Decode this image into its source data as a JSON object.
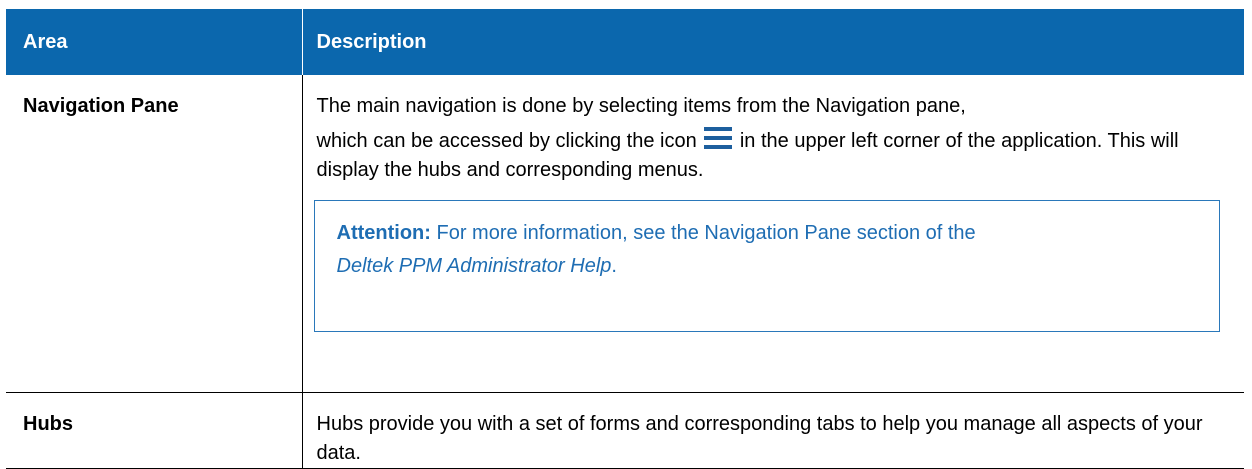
{
  "table": {
    "headers": {
      "area": "Area",
      "description": "Description"
    },
    "rows": {
      "navigation": {
        "area": "Navigation Pane",
        "desc_line1": "The main navigation is done by selecting items from the Navigation pane,",
        "desc_before_icon": "which can be accessed by clicking the icon",
        "icon": "hamburger-menu-icon",
        "desc_after_icon": "in the upper left corner of the application. This will display the hubs and corresponding menus.",
        "attention": {
          "label": "Attention:",
          "text": "For more information, see the Navigation Pane section of the",
          "italic": "Deltek PPM Administrator Help",
          "suffix": "."
        }
      },
      "hubs": {
        "area": "Hubs",
        "description": "Hubs provide you with a set of forms and corresponding tabs to help you manage all aspects of your data."
      }
    }
  },
  "colors": {
    "header_bg": "#0b67ad",
    "header_text": "#ffffff",
    "attention_text": "#1e6db3",
    "attention_border": "#2a78ba"
  }
}
